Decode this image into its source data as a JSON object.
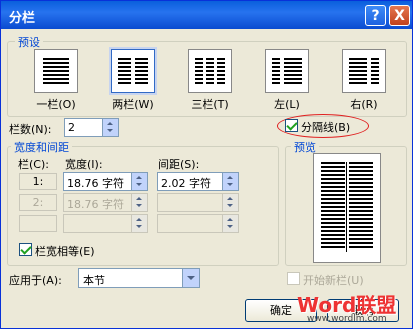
{
  "window": {
    "title": "分栏",
    "help_btn": "?",
    "close_btn": "X"
  },
  "presets": {
    "group_label": "预设",
    "items": [
      {
        "label": "一栏(O)"
      },
      {
        "label": "两栏(W)"
      },
      {
        "label": "三栏(T)"
      },
      {
        "label": "左(L)"
      },
      {
        "label": "右(R)"
      }
    ],
    "selected": "两栏(W)"
  },
  "columns_count": {
    "label": "栏数(N):",
    "value": "2"
  },
  "separator": {
    "label": "分隔线(B)",
    "checked": true
  },
  "width_spacing": {
    "group_label": "宽度和间距",
    "col_header": "栏(C):",
    "width_header": "宽度(I):",
    "spacing_header": "间距(S):",
    "rows": [
      {
        "col": "1:",
        "width": "18.76 字符",
        "spacing": "2.02 字符"
      },
      {
        "col": "2:",
        "width": "18.76 字符",
        "spacing": ""
      },
      {
        "col": "",
        "width": "",
        "spacing": ""
      }
    ]
  },
  "equal_width": {
    "label": "栏宽相等(E)",
    "checked": true
  },
  "preview": {
    "group_label": "预览"
  },
  "apply_to": {
    "label": "应用于(A):",
    "value": "本节"
  },
  "new_column": {
    "label": "开始新栏(U)",
    "checked": false
  },
  "buttons": {
    "ok": "确定",
    "cancel": "取消"
  },
  "watermark": {
    "brand": "Word联盟",
    "url": "www.wordlm.com"
  }
}
